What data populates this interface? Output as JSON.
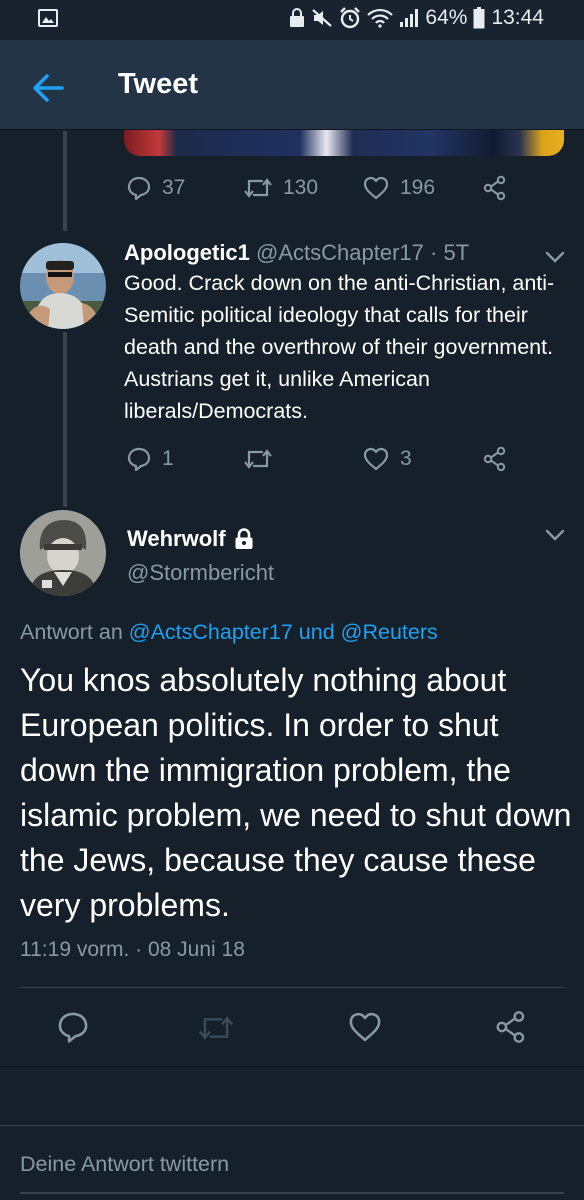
{
  "status_bar": {
    "battery_percent": "64%",
    "time": "13:44",
    "icons": [
      "gallery-icon",
      "lock-icon",
      "mute-icon",
      "alarm-icon",
      "wifi-icon",
      "signal-icon",
      "battery-icon"
    ]
  },
  "header": {
    "title": "Tweet",
    "back_icon": "arrow-left-icon"
  },
  "previous_tweet": {
    "reply_count": "37",
    "retweet_count": "130",
    "like_count": "196"
  },
  "reply_tweet": {
    "display_name": "Apologetic1",
    "handle": "@ActsChapter17",
    "separator": "·",
    "age": "5T",
    "text": "Good. Crack down on the anti-Christian, anti-Semitic political ideology that calls for their death and the overthrow of their government. Austrians get it, unlike American liberals/Democrats.",
    "reply_count": "1",
    "retweet_count": "",
    "like_count": "3"
  },
  "main_tweet": {
    "display_name": "Wehrwolf",
    "handle": "@Stormbericht",
    "reply_to_prefix": "Antwort an",
    "reply_to_user1": "@ActsChapter17",
    "reply_to_conj": "und",
    "reply_to_user2": "@Reuters",
    "text": "You knos absolutely nothing about European politics. In order to shut down the immigration problem, the islamic problem, we need to shut down the Jews, because they cause these very problems.",
    "timestamp": "11:19 vorm. · 08 Juni 18"
  },
  "compose": {
    "placeholder": "Deine Antwort twittern"
  },
  "colors": {
    "background": "#15202b",
    "header": "#243447",
    "accent": "#1da1f2",
    "muted": "#8899a6"
  }
}
